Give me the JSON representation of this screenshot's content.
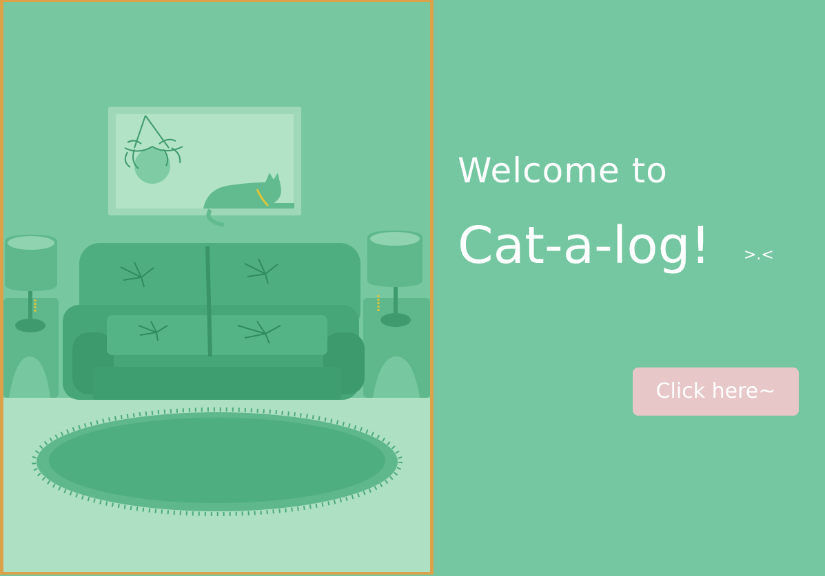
{
  "welcome": {
    "line1": "Welcome to",
    "brand": "Cat-a-log!",
    "emoticon": ">.<"
  },
  "cta": {
    "label": "Click here~"
  },
  "colors": {
    "background": "#74c7a0",
    "frame_border": "#dca24a",
    "button_bg": "#e7c7c7",
    "text": "#ffffff"
  },
  "illustration": {
    "subject": "living-room-with-cat",
    "icons": [
      "hanging-plant-icon",
      "cat-icon",
      "sofa-icon",
      "lamp-icon",
      "rug-icon"
    ]
  }
}
